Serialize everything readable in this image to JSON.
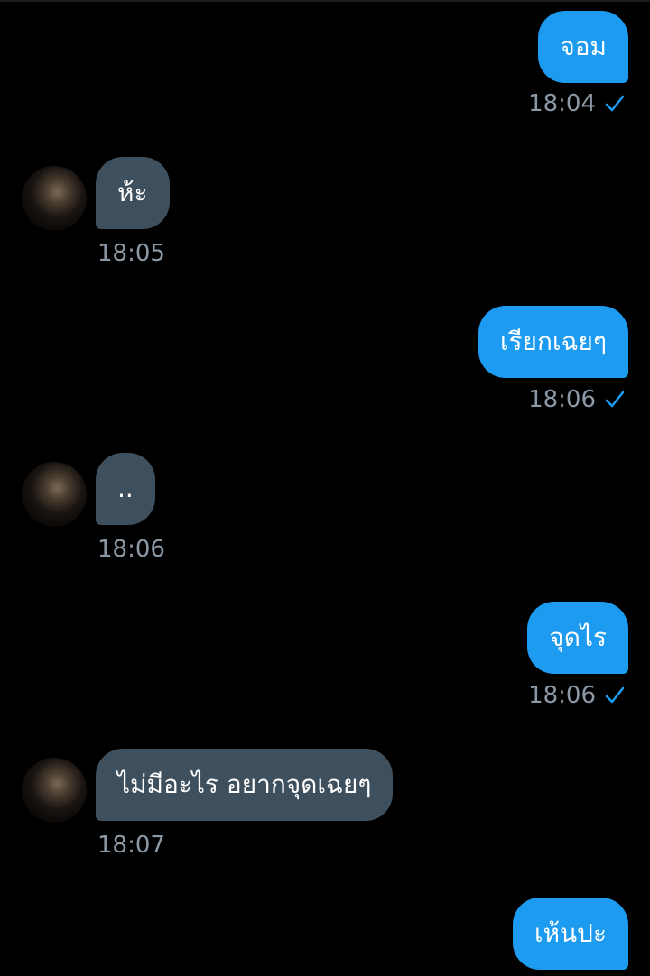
{
  "colors": {
    "background": "#000000",
    "outgoing_bubble": "#1d9bf0",
    "incoming_bubble": "#3e4f5e",
    "timestamp": "#8b98a5",
    "check": "#1d9bf0"
  },
  "messages": [
    {
      "direction": "outgoing",
      "text": "จอม",
      "time": "18:04",
      "status_icon": "check-icon"
    },
    {
      "direction": "incoming",
      "text": "ห้ะ",
      "time": "18:05",
      "avatar": "avatar"
    },
    {
      "direction": "outgoing",
      "text": "เรียกเฉยๆ",
      "time": "18:06",
      "status_icon": "check-icon"
    },
    {
      "direction": "incoming",
      "text": "..",
      "time": "18:06",
      "avatar": "avatar"
    },
    {
      "direction": "outgoing",
      "text": "จุดไร",
      "time": "18:06",
      "status_icon": "check-icon"
    },
    {
      "direction": "incoming",
      "text": "ไม่มีอะไร อยากจุดเฉยๆ",
      "time": "18:07",
      "avatar": "avatar"
    },
    {
      "direction": "outgoing",
      "text": "เห้นปะ"
    }
  ]
}
